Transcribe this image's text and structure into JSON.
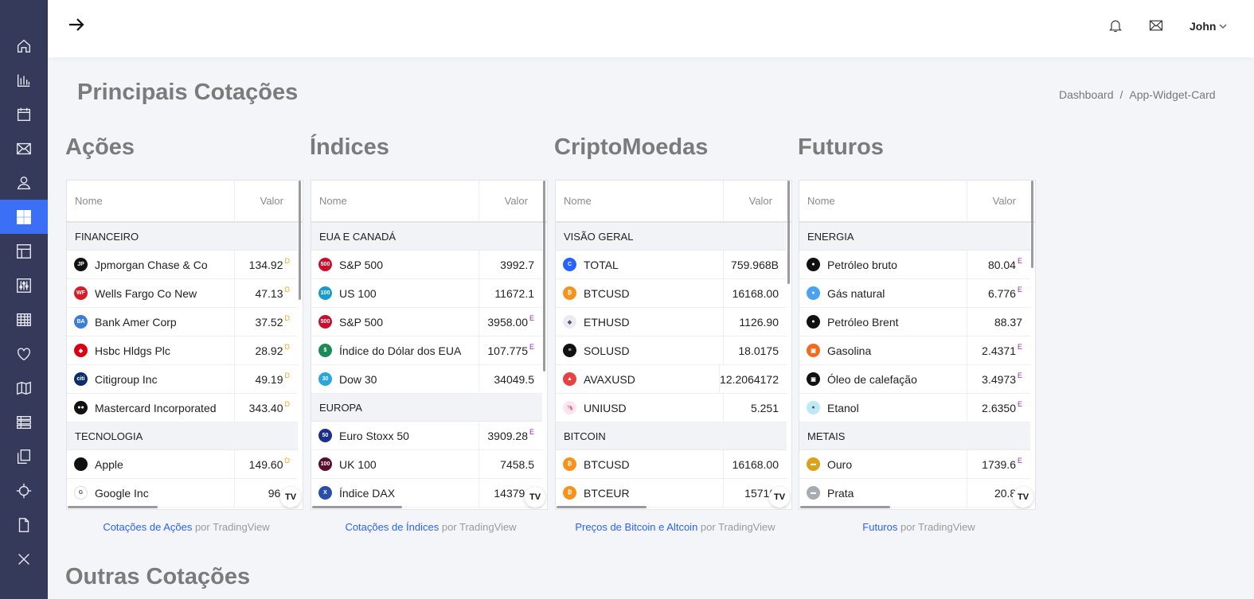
{
  "sidebar": {
    "items": [
      {
        "name": "home-icon",
        "active": false
      },
      {
        "name": "bar-chart-icon",
        "active": false
      },
      {
        "name": "calendar-icon",
        "active": false
      },
      {
        "name": "mail-icon",
        "active": false
      },
      {
        "name": "user-icon",
        "active": false
      },
      {
        "name": "dashboard-grid-icon",
        "active": true
      },
      {
        "name": "layout-icon",
        "active": false
      },
      {
        "name": "sliders-icon",
        "active": false
      },
      {
        "name": "table-grid-icon",
        "active": false
      },
      {
        "name": "heart-icon",
        "active": false
      },
      {
        "name": "map-icon",
        "active": false
      },
      {
        "name": "list-icon",
        "active": false
      },
      {
        "name": "copy-icon",
        "active": false
      },
      {
        "name": "crosshair-icon",
        "active": false
      },
      {
        "name": "file-icon",
        "active": false
      },
      {
        "name": "close-icon",
        "active": false
      }
    ]
  },
  "header": {
    "user_name": "John"
  },
  "page": {
    "title": "Principais Cotações",
    "breadcrumb": [
      "Dashboard",
      "App-Widget-Card"
    ],
    "other_title": "Outras Cotações"
  },
  "widgets": [
    {
      "title": "Ações",
      "col_name": "Nome",
      "col_value": "Valor",
      "groups": [
        {
          "label": "FINANCEIRO",
          "rows": [
            {
              "icon": "jpmorgan-icon",
              "color": "#111111",
              "abbr": "JP",
              "name": "Jpmorgan Chase & Co",
              "value": "134.92",
              "flag": "D"
            },
            {
              "icon": "wells-fargo-icon",
              "color": "#d71e28",
              "abbr": "WF",
              "name": "Wells Fargo Co New",
              "value": "47.13",
              "flag": "D"
            },
            {
              "icon": "bank-amer-icon",
              "color": "#3b7dd8",
              "abbr": "BA",
              "name": "Bank Amer Corp",
              "value": "37.52",
              "flag": "D"
            },
            {
              "icon": "hsbc-icon",
              "color": "#db0011",
              "abbr": "◆",
              "name": "Hsbc Hldgs Plc",
              "value": "28.92",
              "flag": "D"
            },
            {
              "icon": "citigroup-icon",
              "color": "#0b2d6b",
              "abbr": "citi",
              "name": "Citigroup Inc",
              "value": "49.19",
              "flag": "D"
            },
            {
              "icon": "mastercard-icon",
              "color": "#111111",
              "abbr": "●●",
              "name": "Mastercard Incorporated",
              "value": "343.40",
              "flag": "D"
            }
          ]
        },
        {
          "label": "TECNOLOGIA",
          "rows": [
            {
              "icon": "apple-icon",
              "color": "#111111",
              "abbr": "",
              "name": "Apple",
              "value": "149.60",
              "flag": "D"
            },
            {
              "icon": "google-icon",
              "color": "#ffffff",
              "abbr": "G",
              "name": "Google Inc",
              "value": "96.8",
              "flag": ""
            }
          ]
        }
      ],
      "attribution_link": "Cotações de Ações",
      "attribution_rest": " por TradingView"
    },
    {
      "title": "Índices",
      "col_name": "Nome",
      "col_value": "Valor",
      "groups": [
        {
          "label": "EUA E CANADÁ",
          "rows": [
            {
              "icon": "sp500-icon",
              "color": "#c8102e",
              "abbr": "500",
              "name": "S&P 500",
              "value": "3992.7",
              "flag": ""
            },
            {
              "icon": "us100-icon",
              "color": "#1a9bc9",
              "abbr": "100",
              "name": "US 100",
              "value": "11672.1",
              "flag": ""
            },
            {
              "icon": "sp500-icon",
              "color": "#c8102e",
              "abbr": "500",
              "name": "S&P 500",
              "value": "3958.00",
              "flag": "E"
            },
            {
              "icon": "dollar-index-icon",
              "color": "#1e8a5a",
              "abbr": "$",
              "name": "Índice do Dólar dos EUA",
              "value": "107.775",
              "flag": "E"
            },
            {
              "icon": "dow30-icon",
              "color": "#2aa6d8",
              "abbr": "30",
              "name": "Dow 30",
              "value": "34049.5",
              "flag": ""
            }
          ]
        },
        {
          "label": "EUROPA",
          "rows": [
            {
              "icon": "eurostoxx-icon",
              "color": "#1c2f8a",
              "abbr": "50",
              "name": "Euro Stoxx 50",
              "value": "3909.28",
              "flag": "E"
            },
            {
              "icon": "uk100-icon",
              "color": "#5a0f2e",
              "abbr": "100",
              "name": "UK 100",
              "value": "7458.5",
              "flag": ""
            },
            {
              "icon": "dax-icon",
              "color": "#2b4fa8",
              "abbr": "X",
              "name": "Índice DAX",
              "value": "14379.9",
              "flag": ""
            }
          ]
        }
      ],
      "attribution_link": "Cotações de Índices",
      "attribution_rest": " por TradingView"
    },
    {
      "title": "CriptoMoedas",
      "col_name": "Nome",
      "col_value": "Valor",
      "groups": [
        {
          "label": "VISÃO GERAL",
          "rows": [
            {
              "icon": "total-icon",
              "color": "#2962ff",
              "abbr": "C",
              "name": "TOTAL",
              "value": "759.968B",
              "flag": ""
            },
            {
              "icon": "bitcoin-icon",
              "color": "#f7931a",
              "abbr": "₿",
              "name": "BTCUSD",
              "value": "16168.00",
              "flag": ""
            },
            {
              "icon": "ethereum-icon",
              "color": "#ecebf5",
              "abbr": "◆",
              "name": "ETHUSD",
              "value": "1126.90",
              "flag": ""
            },
            {
              "icon": "solana-icon",
              "color": "#111111",
              "abbr": "≡",
              "name": "SOLUSD",
              "value": "18.0175",
              "flag": ""
            },
            {
              "icon": "avalanche-icon",
              "color": "#e84142",
              "abbr": "▲",
              "name": "AVAXUSD",
              "value": "12.2064172",
              "flag": ""
            },
            {
              "icon": "uniswap-icon",
              "color": "#fde4ef",
              "abbr": "🦄",
              "name": "UNIUSD",
              "value": "5.251",
              "flag": ""
            }
          ]
        },
        {
          "label": "BITCOIN",
          "rows": [
            {
              "icon": "bitcoin-icon",
              "color": "#f7931a",
              "abbr": "₿",
              "name": "BTCUSD",
              "value": "16168.00",
              "flag": ""
            },
            {
              "icon": "bitcoin-euro-icon",
              "color": "#f7931a",
              "abbr": "₿",
              "name": "BTCEUR",
              "value": "15710.",
              "flag": ""
            }
          ]
        }
      ],
      "attribution_link": "Preços de Bitcoin e Altcoin",
      "attribution_rest": " por TradingView"
    },
    {
      "title": "Futuros",
      "col_name": "Nome",
      "col_value": "Valor",
      "groups": [
        {
          "label": "ENERGIA",
          "rows": [
            {
              "icon": "crude-oil-icon",
              "color": "#111111",
              "abbr": "●",
              "name": "Petróleo bruto",
              "value": "80.04",
              "flag": "E"
            },
            {
              "icon": "natural-gas-icon",
              "color": "#4aa3f0",
              "abbr": "●",
              "name": "Gás natural",
              "value": "6.776",
              "flag": "E"
            },
            {
              "icon": "brent-oil-icon",
              "color": "#111111",
              "abbr": "●",
              "name": "Petróleo Brent",
              "value": "88.37",
              "flag": ""
            },
            {
              "icon": "gasoline-icon",
              "color": "#f26b1d",
              "abbr": "▣",
              "name": "Gasolina",
              "value": "2.4371",
              "flag": "E"
            },
            {
              "icon": "heating-oil-icon",
              "color": "#111111",
              "abbr": "▣",
              "name": "Óleo de calefação",
              "value": "3.4973",
              "flag": "E"
            },
            {
              "icon": "ethanol-icon",
              "color": "#bfe8f7",
              "abbr": "●",
              "name": "Etanol",
              "value": "2.6350",
              "flag": "E"
            }
          ]
        },
        {
          "label": "METAIS",
          "rows": [
            {
              "icon": "gold-icon",
              "color": "#d9a21b",
              "abbr": "▬",
              "name": "Ouro",
              "value": "1739.6",
              "flag": "E"
            },
            {
              "icon": "silver-icon",
              "color": "#a9abb3",
              "abbr": "▬",
              "name": "Prata",
              "value": "20.87",
              "flag": ""
            }
          ]
        }
      ],
      "attribution_link": "Futuros",
      "attribution_rest": " por TradingView"
    }
  ]
}
